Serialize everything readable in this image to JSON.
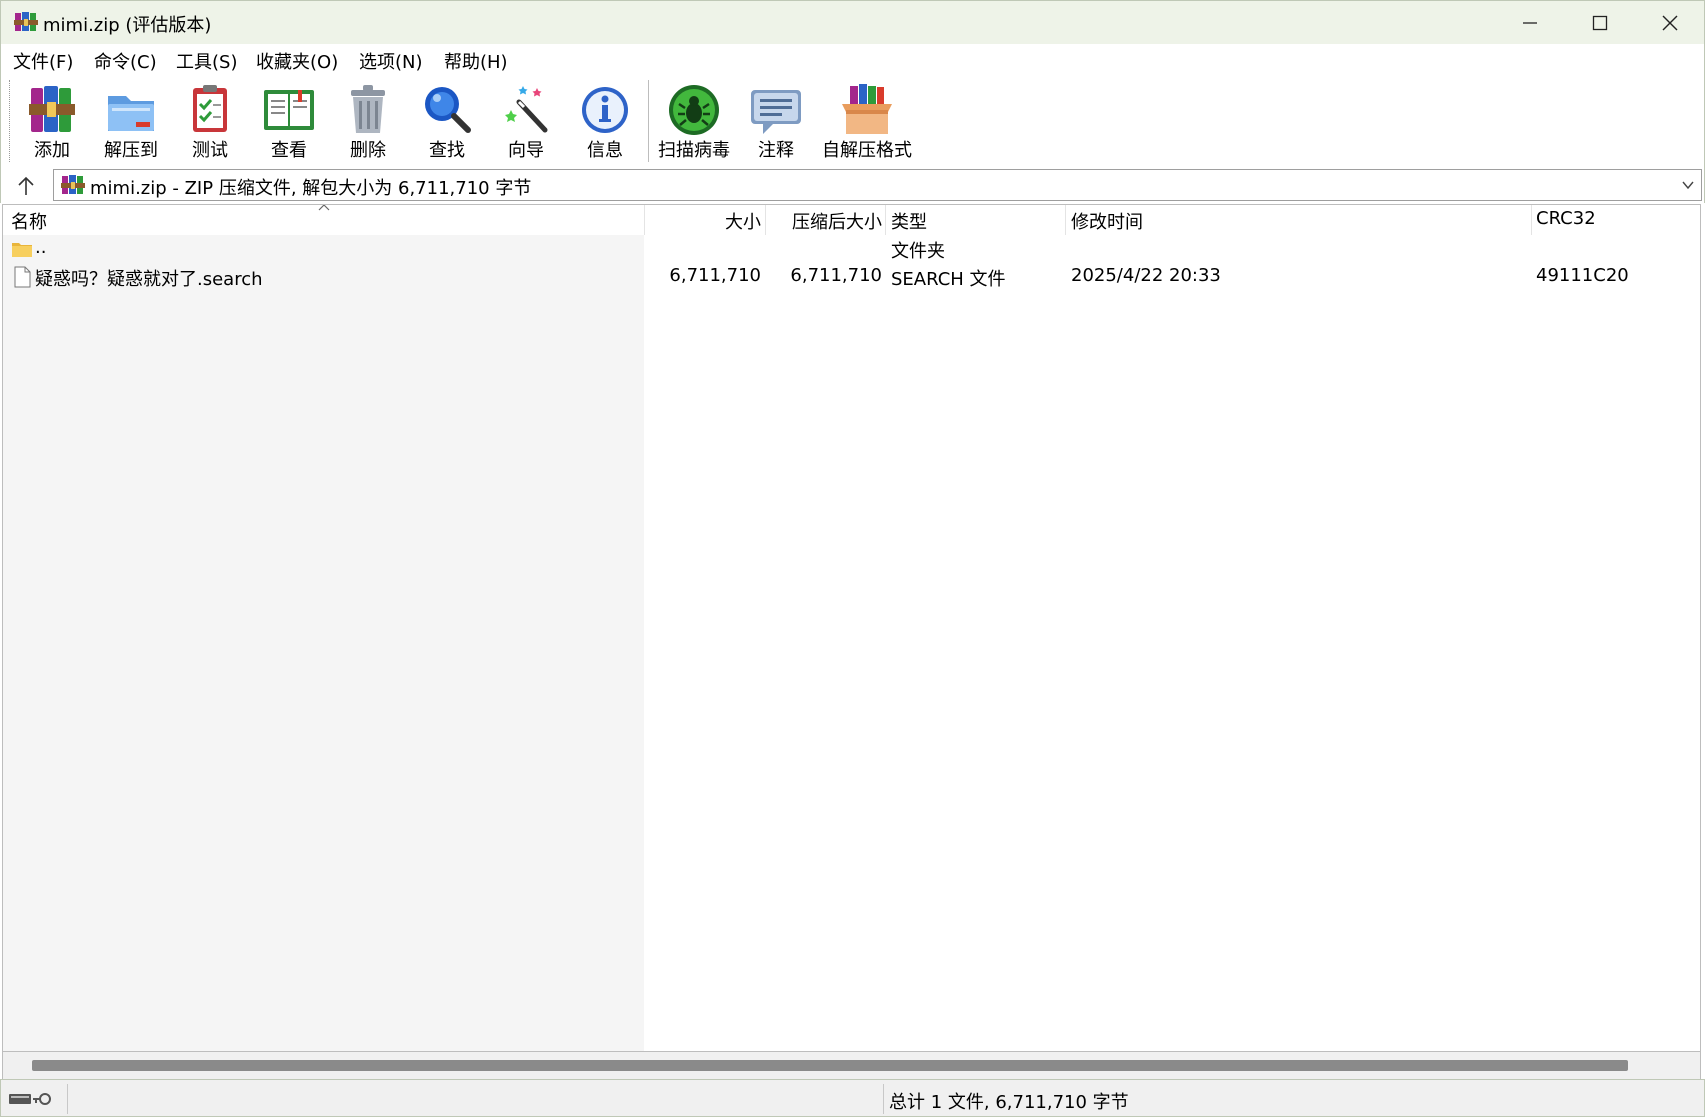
{
  "window": {
    "title": "mimi.zip (评估版本)",
    "minimize_icon": "minimize-icon",
    "maximize_icon": "maximize-icon",
    "close_icon": "close-icon"
  },
  "menu": [
    {
      "label": "文件(F)"
    },
    {
      "label": "命令(C)"
    },
    {
      "label": "工具(S)"
    },
    {
      "label": "收藏夹(O)"
    },
    {
      "label": "选项(N)"
    },
    {
      "label": "帮助(H)"
    }
  ],
  "toolbar": [
    {
      "label": "添加",
      "icon": "add-archive-icon"
    },
    {
      "label": "解压到",
      "icon": "extract-folder-icon"
    },
    {
      "label": "测试",
      "icon": "test-clipboard-icon"
    },
    {
      "label": "查看",
      "icon": "view-book-icon"
    },
    {
      "label": "删除",
      "icon": "trash-icon"
    },
    {
      "label": "查找",
      "icon": "magnifier-icon"
    },
    {
      "label": "向导",
      "icon": "wizard-wand-icon"
    },
    {
      "label": "信息",
      "icon": "info-icon"
    },
    {
      "label": "扫描病毒",
      "icon": "virus-scan-icon"
    },
    {
      "label": "注释",
      "icon": "comment-icon"
    },
    {
      "label": "自解压格式",
      "icon": "sfx-box-icon"
    }
  ],
  "address": {
    "text": "mimi.zip - ZIP 压缩文件, 解包大小为 6,711,710 字节",
    "up_icon": "up-arrow-icon",
    "dropdown_icon": "chevron-down-icon"
  },
  "columns": {
    "name": "名称",
    "size": "大小",
    "packed": "压缩后大小",
    "type": "类型",
    "modified": "修改时间",
    "crc": "CRC32"
  },
  "rows": [
    {
      "name": "..",
      "size": "",
      "packed": "",
      "type": "文件夹",
      "modified": "",
      "crc": "",
      "icon": "folder-icon"
    },
    {
      "name": "疑惑吗？疑惑就对了.search",
      "size": "6,711,710",
      "packed": "6,711,710",
      "type": "SEARCH 文件",
      "modified": "2025/4/22 20:33",
      "crc": "49111C20",
      "icon": "file-icon"
    }
  ],
  "status": {
    "text": "总计 1 文件, 6,711,710 字节"
  },
  "colors": {
    "titlebar": "#eef3e8",
    "name_column_bg": "#f5f5f5",
    "scroll_thumb": "#8a8a8a"
  }
}
